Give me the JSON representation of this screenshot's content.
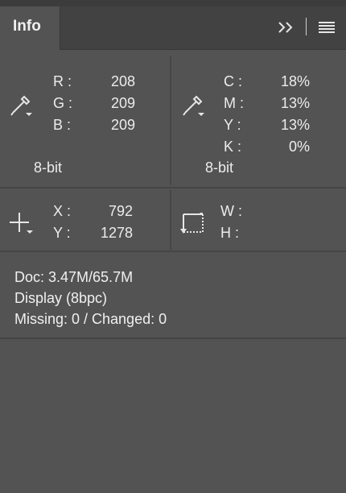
{
  "tab": {
    "label": "Info"
  },
  "header": {
    "collapse_icon": "double-chevron-right-icon",
    "menu_icon": "hamburger-menu-icon"
  },
  "rgb": {
    "icon": "eyedropper-icon",
    "rows": [
      {
        "label": "R :",
        "value": "208"
      },
      {
        "label": "G :",
        "value": "209"
      },
      {
        "label": "B :",
        "value": "209"
      }
    ],
    "bit_depth": "8-bit"
  },
  "cmyk": {
    "icon": "eyedropper-icon",
    "rows": [
      {
        "label": "C :",
        "value": "18%"
      },
      {
        "label": "M :",
        "value": "13%"
      },
      {
        "label": "Y :",
        "value": "13%"
      },
      {
        "label": "K :",
        "value": "0%"
      }
    ],
    "bit_depth": "8-bit"
  },
  "position": {
    "icon": "crosshair-icon",
    "rows": [
      {
        "label": "X :",
        "value": "792"
      },
      {
        "label": "Y :",
        "value": "1278"
      }
    ]
  },
  "size": {
    "icon": "selection-size-icon",
    "rows": [
      {
        "label": "W :",
        "value": ""
      },
      {
        "label": "H :",
        "value": ""
      }
    ]
  },
  "document": {
    "doc_size": "Doc: 3.47M/65.7M",
    "display": "Display (8bpc)",
    "missing_changed": "Missing: 0 / Changed: 0"
  },
  "colors": {
    "panel_bg": "#535353",
    "header_bg": "#424242",
    "text": "#ececec"
  }
}
